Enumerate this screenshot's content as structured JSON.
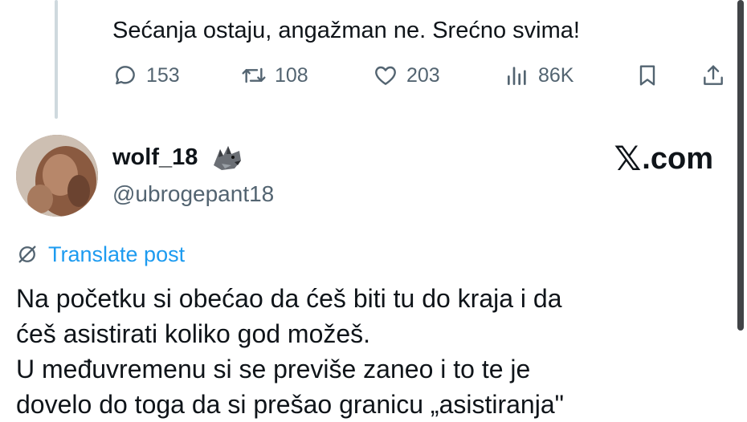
{
  "previous_post": {
    "text": "Sećanja ostaju, angažman ne. Srećno svima!",
    "actions": {
      "replies": "153",
      "reposts": "108",
      "likes": "203",
      "views": "86K"
    }
  },
  "post": {
    "display_name": "wolf_18",
    "name_emoji_icon": "wolf-emoji-icon",
    "handle": "@ubrogepant18",
    "brand": ".com",
    "translate_label": "Translate post",
    "lines": [
      "Na početku si obećao da ćeš biti tu do kraja i da",
      "ćeš asistirati koliko god možeš.",
      "U međuvremenu si se previše zaneo i to te je",
      "dovelo do toga da si prešao granicu „asistiranja\""
    ]
  },
  "icons": {
    "reply": "speech-bubble-icon",
    "repost": "repost-arrows-icon",
    "like": "heart-icon",
    "views": "bar-chart-icon",
    "bookmark": "bookmark-icon",
    "share": "share-upload-icon",
    "translate": "globe-slash-icon"
  },
  "colors": {
    "text": "#0f1419",
    "secondary": "#536471",
    "link": "#1d9bf0",
    "thread_line": "#cfd9de"
  }
}
